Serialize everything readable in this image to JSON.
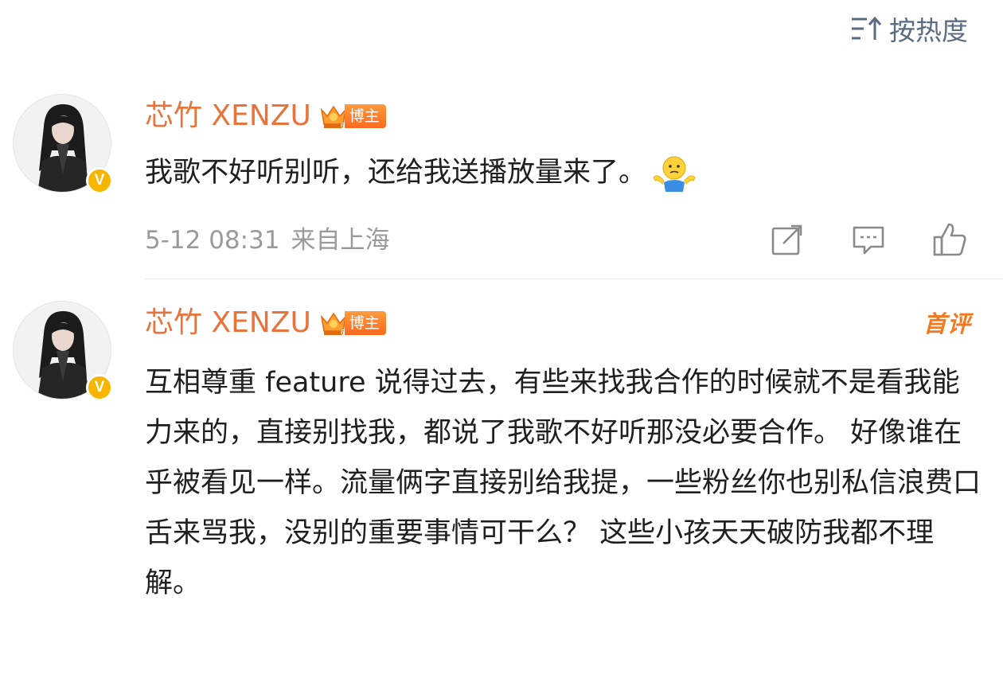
{
  "sort": {
    "label": "按热度",
    "icon": "sort-order-icon"
  },
  "comments": [
    {
      "username": "芯竹 XENZU",
      "role_badge": "博主",
      "text": "我歌不好听别听，还给我送播放量来了。",
      "emoji": "shrug-emoji",
      "date": "5-12 08:31",
      "location": "来自上海",
      "actions": [
        "share-icon",
        "comment-icon",
        "like-icon"
      ]
    },
    {
      "username": "芯竹 XENZU",
      "role_badge": "博主",
      "tag": "首评",
      "text": "互相尊重 feature 说得过去，有些来找我合作的时候就不是看我能力来的，直接别找我，都说了我歌不好听那没必要合作。 好像谁在乎被看见一样。流量俩字直接别给我提，一些粉丝你也别私信浪费口舌来骂我，没别的重要事情可干么？ 这些小孩天天破防我都不理解。"
    }
  ],
  "colors": {
    "username": "#e8743b",
    "badge": "#ff7a2a",
    "verified": "#f7b500",
    "meta": "#9a9a9a",
    "sort": "#5a6b82"
  }
}
